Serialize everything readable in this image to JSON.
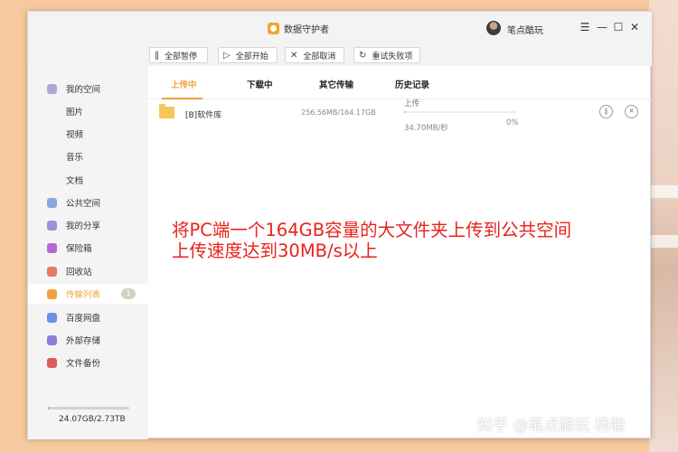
{
  "window": {
    "title": "数据守护者",
    "username": "笔点酷玩"
  },
  "window_controls": {
    "menu": "☰",
    "minimize": "—",
    "maximize": "☐",
    "close": "✕"
  },
  "toolbar": [
    {
      "icon": "‖",
      "label": "全部暂停"
    },
    {
      "icon": "▷",
      "label": "全部开始"
    },
    {
      "icon": "✕",
      "label": "全部取消"
    },
    {
      "icon": "↻",
      "label": "重试失败项"
    }
  ],
  "sidebar": {
    "items": [
      {
        "label": "我的空间",
        "icon": "my-space-icon",
        "color": "#a9a9d6"
      },
      {
        "label": "图片"
      },
      {
        "label": "视频"
      },
      {
        "label": "音乐"
      },
      {
        "label": "文档"
      },
      {
        "label": "公共空间",
        "icon": "public-space-icon",
        "color": "#8aa7dc"
      },
      {
        "label": "我的分享",
        "icon": "share-icon",
        "color": "#a38be0"
      },
      {
        "label": "保险箱",
        "icon": "safe-icon",
        "color": "#b36bd3"
      },
      {
        "label": "回收站",
        "icon": "recycle-bin-icon",
        "color": "#e67b63"
      },
      {
        "label": "传输列表",
        "icon": "transfer-icon",
        "color": "#f0a23a",
        "badge": "1"
      },
      {
        "label": "百度网盘",
        "icon": "baidu-pan-icon",
        "color": "#6a8fe6"
      },
      {
        "label": "外部存储",
        "icon": "external-storage-icon",
        "color": "#8a7fdc"
      },
      {
        "label": "文件备份",
        "icon": "backup-icon",
        "color": "#df5a5a"
      }
    ],
    "storage": {
      "text": "24.07GB/2.73TB",
      "used_fraction": 0.009
    }
  },
  "tabs": [
    {
      "label": "上传中",
      "active": true
    },
    {
      "label": "下载中"
    },
    {
      "label": "其它传输"
    },
    {
      "label": "历史记录"
    }
  ],
  "transfer": {
    "name": "[B]软件库",
    "size": "256.56MB/164.17GB",
    "status": "上传",
    "speed": "34.70MB/秒",
    "percent": "0%",
    "progress_fraction": 0.002
  },
  "overlay": {
    "line1": "将PC端一个164GB容量的大文件夹上传到公共空间",
    "line2": "上传速度达到30MB/s以上"
  },
  "watermark": "知乎 @笔点酷玩 杨聪",
  "colors": {
    "accent": "#f0a23a",
    "overlay_red": "#e8221c"
  }
}
